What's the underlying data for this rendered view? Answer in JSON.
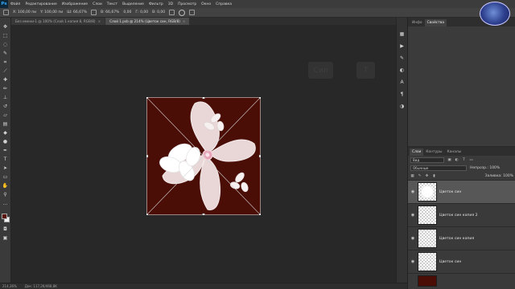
{
  "app": {
    "logo": "Ps"
  },
  "menubar": {
    "items": [
      "Файл",
      "Редактирование",
      "Изображение",
      "Слои",
      "Текст",
      "Выделение",
      "Фильтр",
      "3D",
      "Просмотр",
      "Окно",
      "Справка"
    ]
  },
  "options": {
    "x": "X: 100,00 пи",
    "y": "Y: 100,00 пи",
    "w": "Ш: 66,67%",
    "h": "В: 66,67%",
    "angle": "0,00",
    "hskew": "Г: 0,00",
    "vskew": "В: 0,00"
  },
  "tabs": [
    {
      "label": "Без имени-1 @ 100% (Слой 1 копия 8, RGB/8)",
      "active": false
    },
    {
      "label": "Слой 1.psb @ 214% (Цветок син, RGB/8)",
      "active": true
    }
  ],
  "workspace": {
    "ghost_button_1": "Сил",
    "ghost_button_2": "Т"
  },
  "right_panel": {
    "tabs": [
      "Инфо",
      "Свойства"
    ],
    "layers_tabs": [
      "Слои",
      "Контуры",
      "Каналы"
    ],
    "filter_label": "Вид",
    "blend_mode": "Обычные",
    "opacity": "Непрозр.: 100%",
    "fill": "Заливка: 100%"
  },
  "layers": [
    {
      "name": "Цветок син",
      "selected": true,
      "thumb": "checker"
    },
    {
      "name": "Цветок син копия 2",
      "selected": false,
      "thumb": "checker"
    },
    {
      "name": "Цветок син копия",
      "selected": false,
      "thumb": "checker"
    },
    {
      "name": "Цветок син",
      "selected": false,
      "thumb": "checker"
    },
    {
      "name": "",
      "selected": false,
      "thumb": "solid"
    }
  ],
  "status": {
    "zoom": "214,36%",
    "doc": "Док: 117,2K/468,8K"
  },
  "colors": {
    "canvas_bg": "#4b0e07",
    "foreground": "#5a1208",
    "background": "#f2f2f2"
  }
}
